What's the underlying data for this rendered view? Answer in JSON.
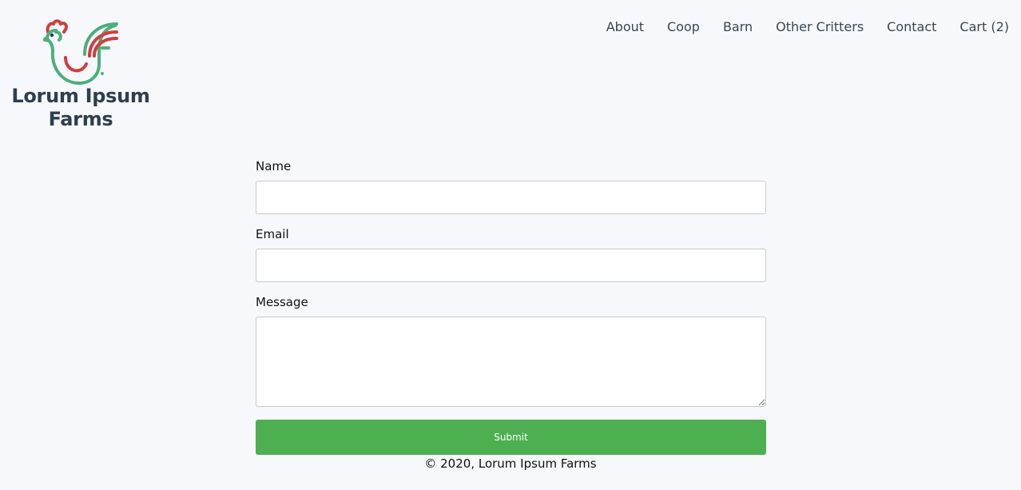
{
  "brand": {
    "name": "Lorum Ipsum Farms",
    "logo_icon": "rooster-icon",
    "colors": {
      "green": "#4caf7a",
      "red": "#d33c3c",
      "text": "#2e3f4f"
    }
  },
  "nav": {
    "items": [
      {
        "label": "About"
      },
      {
        "label": "Coop"
      },
      {
        "label": "Barn"
      },
      {
        "label": "Other Critters"
      },
      {
        "label": "Contact"
      },
      {
        "label": "Cart (2)"
      }
    ]
  },
  "form": {
    "name_label": "Name",
    "name_value": "",
    "email_label": "Email",
    "email_value": "",
    "message_label": "Message",
    "message_value": "",
    "submit_label": "Submit",
    "submit_color": "#4caf50"
  },
  "footer": {
    "text": "© 2020, Lorum Ipsum Farms"
  }
}
